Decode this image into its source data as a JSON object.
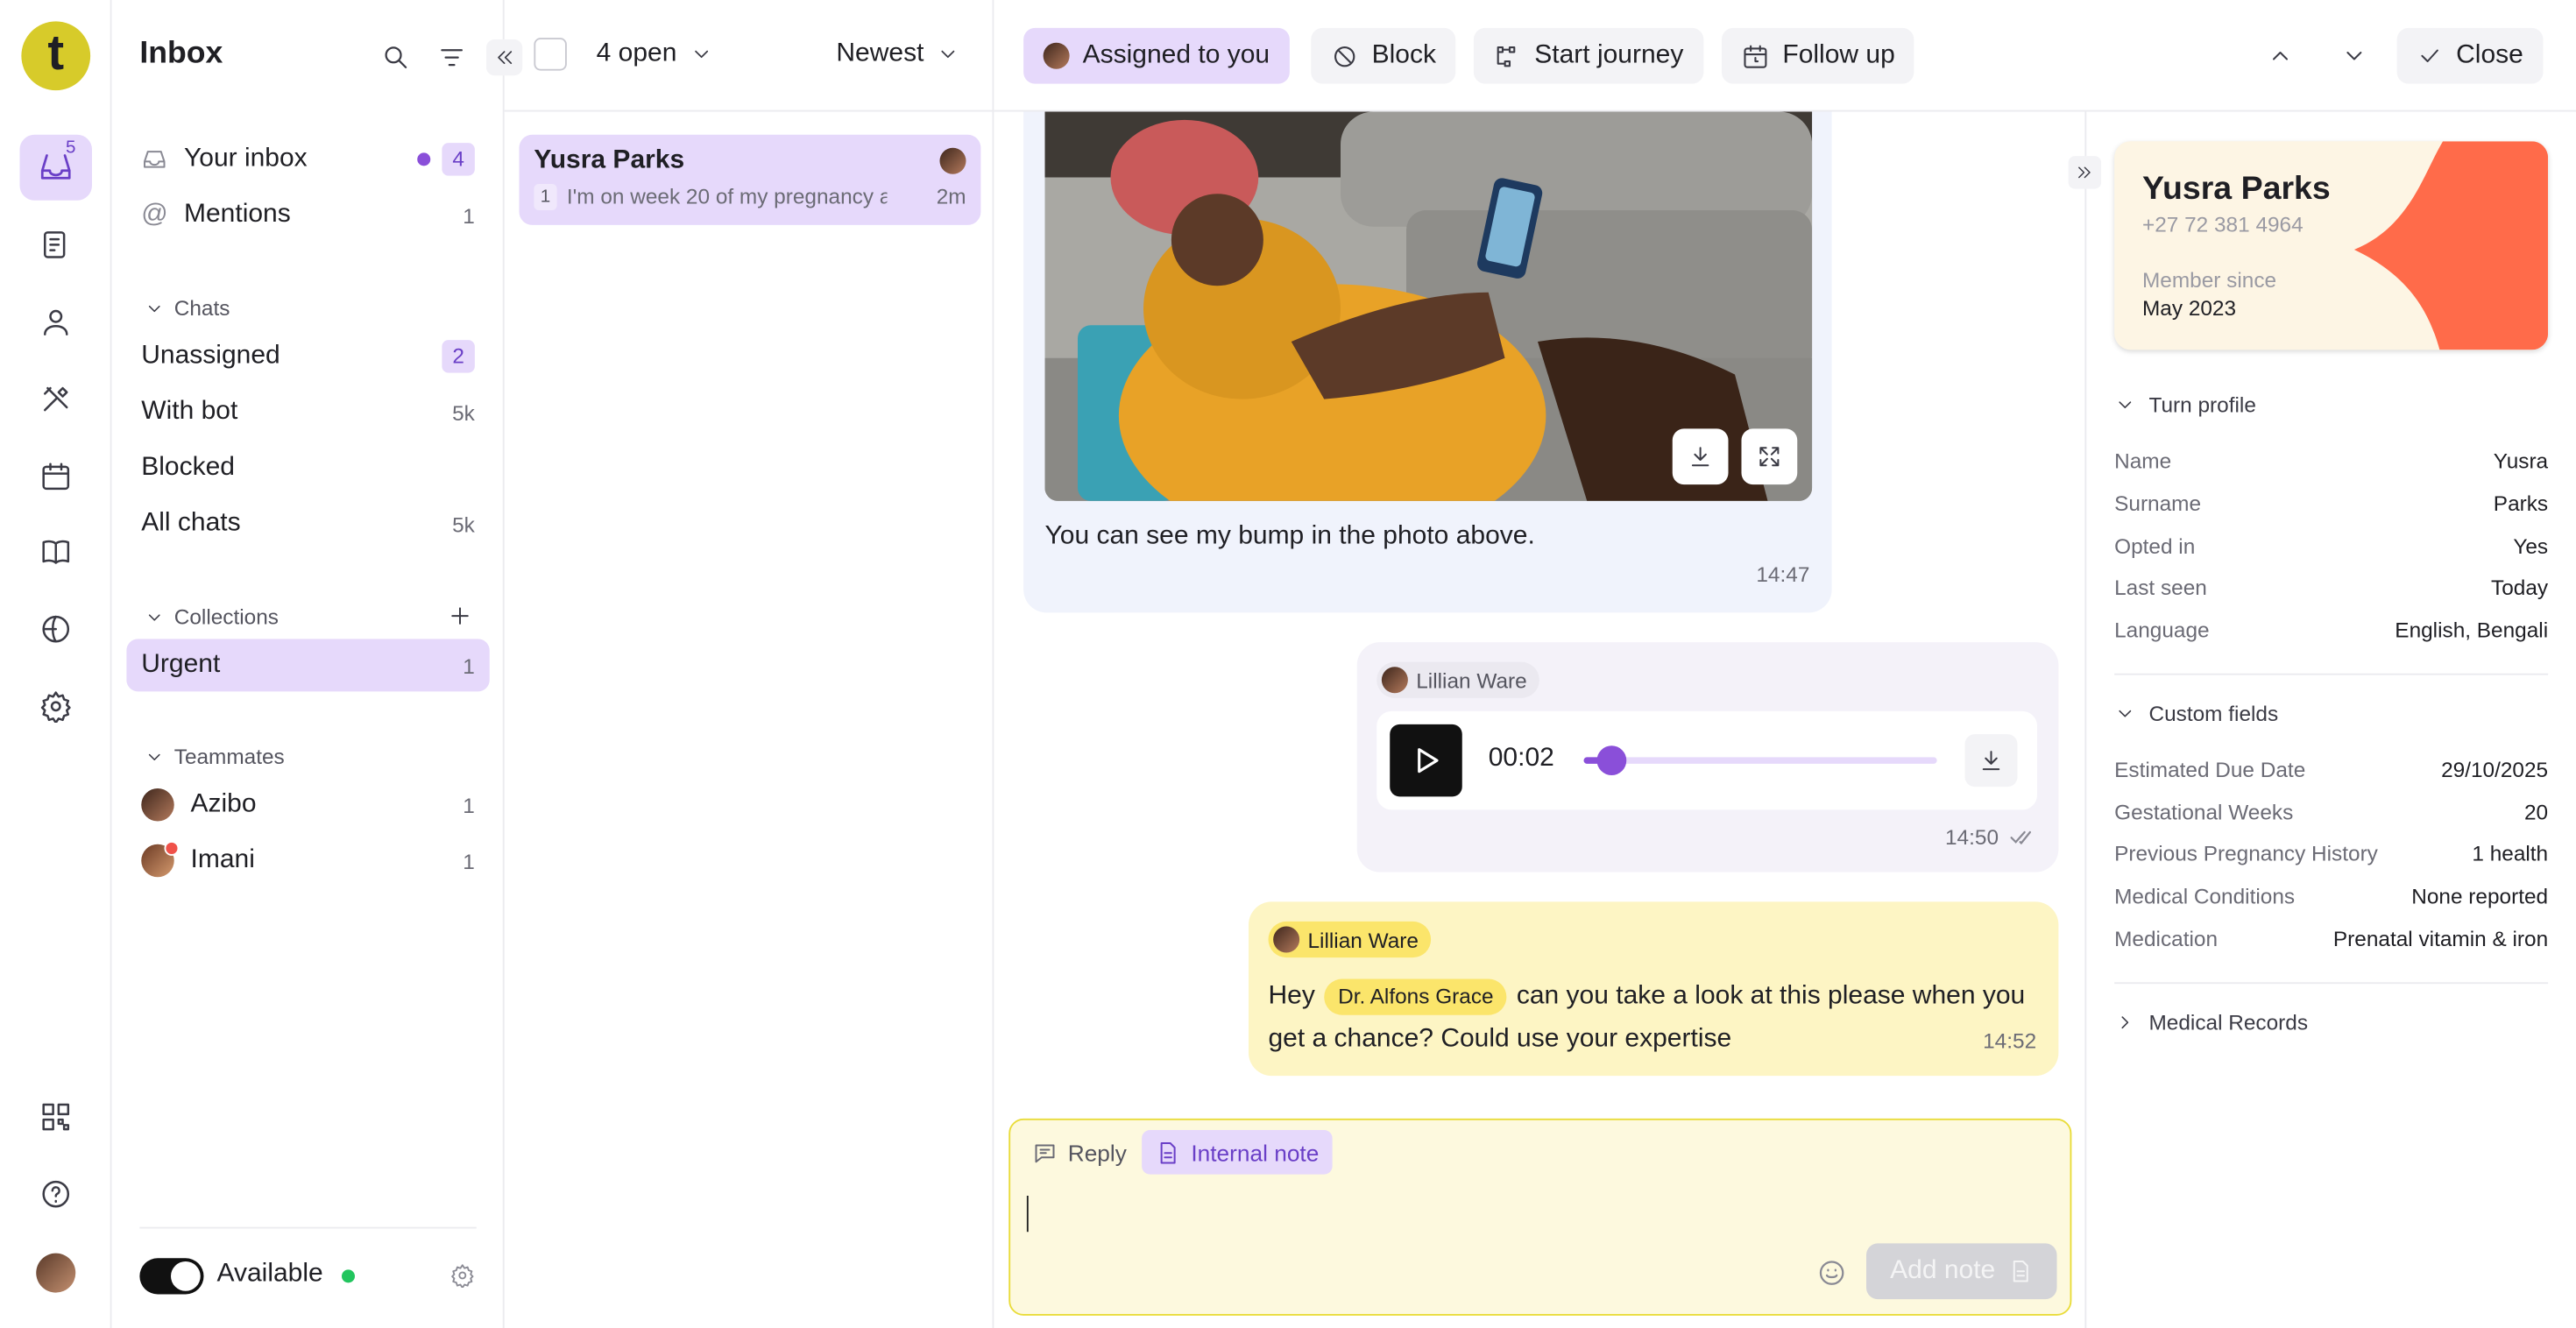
{
  "app": {
    "logo_letter": "t",
    "inbox_badge": "5"
  },
  "sidebar": {
    "title": "Inbox",
    "your_inbox": {
      "label": "Your inbox",
      "count": "4"
    },
    "mentions": {
      "label": "Mentions",
      "count": "1"
    },
    "chats_header": "Chats",
    "chats": [
      {
        "label": "Unassigned",
        "count": "2"
      },
      {
        "label": "With bot",
        "count": "5k"
      },
      {
        "label": "Blocked",
        "count": ""
      },
      {
        "label": "All chats",
        "count": "5k"
      }
    ],
    "collections_header": "Collections",
    "collections": [
      {
        "label": "Urgent",
        "count": "1"
      }
    ],
    "teammates_header": "Teammates",
    "teammates": [
      {
        "label": "Azibo",
        "count": "1"
      },
      {
        "label": "Imani",
        "count": "1"
      }
    ],
    "status_label": "Available"
  },
  "list_toolbar": {
    "filter": "4 open",
    "sort": "Newest"
  },
  "conversations": [
    {
      "name": "Yusra Parks",
      "unread": "1",
      "preview": "I'm on week 20 of my pregnancy a...",
      "time": "2m"
    }
  ],
  "toolbar": {
    "assigned": "Assigned to you",
    "block": "Block",
    "journey": "Start journey",
    "follow_up": "Follow up",
    "close": "Close"
  },
  "messages": {
    "image_caption": "You can see my bump in the photo above.",
    "image_time": "14:47",
    "audio_author": "Lillian Ware",
    "audio_duration": "00:02",
    "audio_progress": 0.08,
    "audio_time": "14:50",
    "note_author": "Lillian Ware",
    "note_pre": "Hey",
    "note_mention": "Dr. Alfons Grace",
    "note_text_1": "can you take a look at this please when you",
    "note_text_2": "get a chance? Could use your expertise",
    "note_time": "14:52"
  },
  "composer": {
    "reply_tab": "Reply",
    "note_tab": "Internal note",
    "submit": "Add note"
  },
  "profile": {
    "name": "Yusra Parks",
    "phone": "+27 72 381 4964",
    "member_since_label": "Member since",
    "member_since": "May 2023",
    "accent_color": "#ff6b4a",
    "turn_profile_header": "Turn profile",
    "fields": [
      {
        "k": "Name",
        "v": "Yusra"
      },
      {
        "k": "Surname",
        "v": "Parks"
      },
      {
        "k": "Opted in",
        "v": "Yes"
      },
      {
        "k": "Last seen",
        "v": "Today"
      },
      {
        "k": "Language",
        "v": "English, Bengali"
      }
    ],
    "custom_header": "Custom fields",
    "custom": [
      {
        "k": "Estimated Due Date",
        "v": "29/10/2025"
      },
      {
        "k": "Gestational Weeks",
        "v": "20"
      },
      {
        "k": "Previous Pregnancy History",
        "v": "1 health"
      },
      {
        "k": "Medical Conditions",
        "v": "None reported"
      },
      {
        "k": "Medication",
        "v": "Prenatal vitamin & iron"
      }
    ],
    "records_header": "Medical Records"
  }
}
